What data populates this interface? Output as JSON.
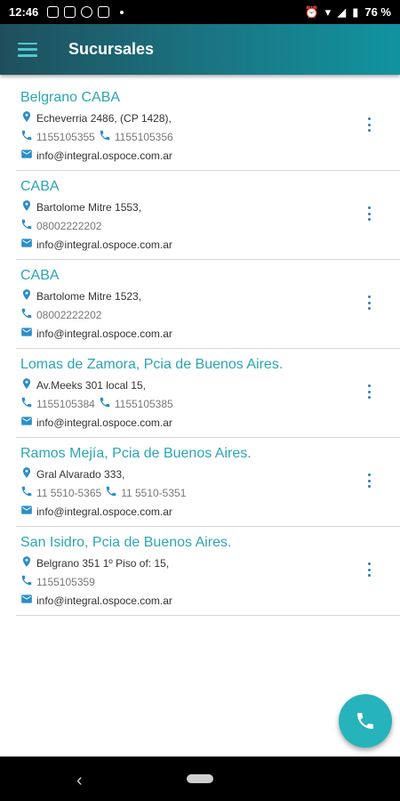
{
  "status_bar": {
    "time": "12:46",
    "battery": "76 %"
  },
  "app_bar": {
    "title": "Sucursales",
    "menu_icon": "hamburger-menu-icon"
  },
  "colors": {
    "accent": "#2aa6b3",
    "app_bar_start": "#1f4f5c",
    "app_bar_end": "#11939f",
    "fab": "#27b3bb"
  },
  "branches": [
    {
      "name": "Belgrano  CABA",
      "address": "Echeverria 2486, (CP 1428),",
      "phone1": "1155105355",
      "phone2": "1155105356",
      "email": "info@integral.ospoce.com.ar"
    },
    {
      "name": "CABA",
      "address": "Bartolome Mitre 1553,",
      "phone1": "08002222202",
      "email": "info@integral.ospoce.com.ar"
    },
    {
      "name": "CABA",
      "address": "Bartolome Mitre 1523,",
      "phone1": "08002222202",
      "email": "info@integral.ospoce.com.ar"
    },
    {
      "name": "Lomas de Zamora, Pcia de Buenos Aires.",
      "address": "Av.Meeks 301 local 15,",
      "phone1": "1155105384",
      "phone2": "1155105385",
      "email": "info@integral.ospoce.com.ar"
    },
    {
      "name": "Ramos Mejía, Pcia de Buenos Aires.",
      "address": "Gral Alvarado 333,",
      "phone1": "11 5510-5365",
      "phone2": "11 5510-5351",
      "email": "info@integral.ospoce.com.ar"
    },
    {
      "name": "San Isidro, Pcia de Buenos Aires.",
      "address": "Belgrano 351 1º Piso of: 15,",
      "phone1": "1155105359",
      "email": "info@integral.ospoce.com.ar"
    }
  ],
  "fab": {
    "icon": "phone-icon"
  }
}
